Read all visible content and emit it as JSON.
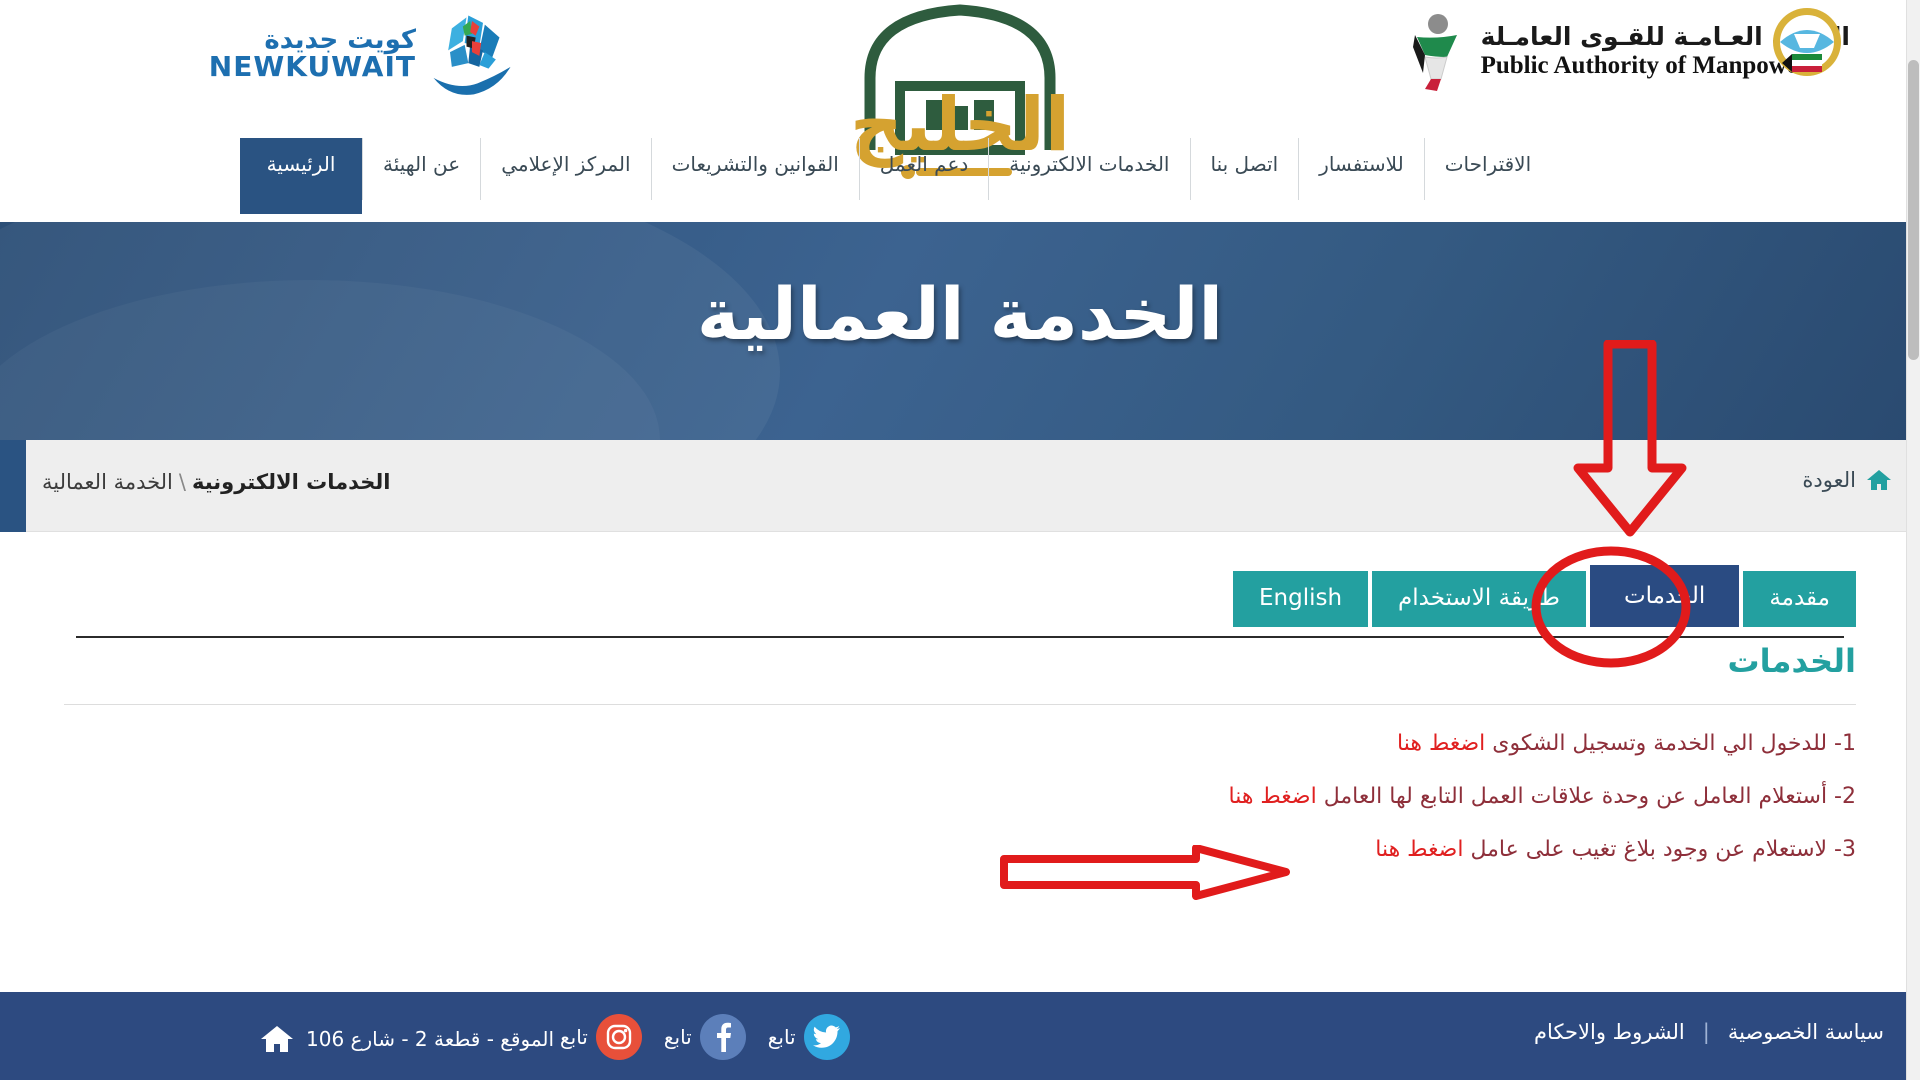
{
  "header": {
    "newkuwait_logo": {
      "arabic": "كويت جديدة",
      "english": "NEWKUWAIT",
      "icon": "newkuwait-sail-logo"
    },
    "authority_logo": {
      "arabic": "الهيئـة العـامـة للقـوى العامـلة",
      "english": "Public Authority of Manpower",
      "emblem": "kuwait-state-emblem"
    },
    "center_logo": {
      "name": "al-khaleej-logo",
      "text": "الخليج"
    }
  },
  "nav": {
    "items": [
      {
        "label": "الاقتراحات",
        "active": false
      },
      {
        "label": "للاستفسار",
        "active": false
      },
      {
        "label": "اتصل بنا",
        "active": false
      },
      {
        "label": "الخدمات الالكترونية",
        "active": false
      },
      {
        "label": "دعم العمل",
        "active": false
      },
      {
        "label": "القوانين والتشريعات",
        "active": false
      },
      {
        "label": "المركز الإعلامي",
        "active": false
      },
      {
        "label": "عن الهيئة",
        "active": false
      },
      {
        "label": "الرئيسية",
        "active": true
      }
    ]
  },
  "hero": {
    "title": "الخدمة العمالية"
  },
  "breadcrumb": {
    "parent": "الخدمات الالكترونية",
    "separator": "\\",
    "current": "الخدمة العمالية",
    "back_label": "العودة",
    "home_icon": "home-icon"
  },
  "tabs": [
    {
      "label": "English",
      "active": false
    },
    {
      "label": "طريقة الاستخدام",
      "active": false
    },
    {
      "label": "الخدمات",
      "active": true
    },
    {
      "label": "مقدمة",
      "active": false
    }
  ],
  "section": {
    "title": "الخدمات",
    "items": [
      {
        "prefix": "1- للدخول الي الخدمة وتسجيل الشكوى",
        "link": "اضغط هنا"
      },
      {
        "prefix": "2- أستعلام العامل عن وحدة علاقات العمل التابع لها العامل",
        "link": "اضغط هنا"
      },
      {
        "prefix": "3- لاستعلام عن وجود بلاغ تغيب على عامل",
        "link": "اضغط هنا"
      }
    ]
  },
  "footer": {
    "links": [
      {
        "label": "سياسة الخصوصية"
      },
      {
        "label": "|"
      },
      {
        "label": "الشروط والاحكام"
      }
    ],
    "privacy": "سياسة الخصوصية",
    "separator": "|",
    "terms": "الشروط والاحكام",
    "social": [
      {
        "network": "twitter-icon",
        "label": "تابع"
      },
      {
        "network": "facebook-icon",
        "label": "تابع"
      },
      {
        "network": "instagram-icon",
        "label": "تابع"
      }
    ],
    "address": "الموقع - قطعة 2 - شارع 106",
    "address_icon": "home-icon"
  },
  "annotations": {
    "arrow_down": "red-down-arrow-pointing-to-services-tab",
    "circle": "red-circle-highlighting-services-tab",
    "arrow_right": "red-right-arrow-pointing-to-third-service-link",
    "color": "#e11b1b"
  },
  "colors": {
    "brand_blue": "#2a5382",
    "teal": "#23a0a0",
    "active_tab": "#2a4b82",
    "footer_blue": "#2d4a80",
    "link_red": "#e02020",
    "text_maroon": "#8e2f3a",
    "vine_green": "#4f9a3f"
  }
}
